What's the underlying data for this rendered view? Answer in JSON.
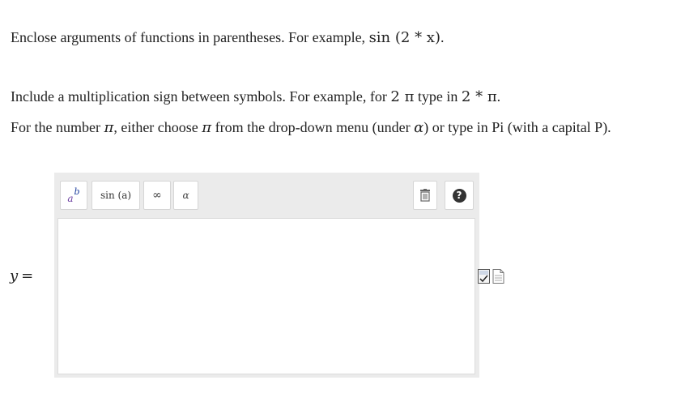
{
  "instructions": {
    "line1_text": "Enclose arguments of functions in parentheses. For example, ",
    "line1_example": "sin (2 * x)",
    "line1_end": ".",
    "line2_text": "Include a multiplication sign between symbols. For example, for ",
    "line2_example_a": "2 π",
    "line2_mid": " type in ",
    "line2_example_b": "2 * π",
    "line2_end": ".",
    "line3_text_a": "For the number ",
    "line3_pi": "π",
    "line3_text_b": ", either choose ",
    "line3_pi2": "π",
    "line3_text_c": " from the drop-down menu (under ",
    "line3_alpha": "α",
    "line3_text_d": ") or type in Pi (with a capital P)."
  },
  "answer": {
    "lhs_var": "y",
    "lhs_eq": "="
  },
  "toolbar": {
    "power_base": "a",
    "power_exp": "b",
    "func_label": "sin (a)",
    "infinity_label": "∞",
    "greek_label": "α"
  },
  "icons": {
    "trash": "trash-icon",
    "help": "help-icon",
    "help_glyph": "?",
    "spellcheck": "equation-preview-icon",
    "doc": "document-icon"
  },
  "colors": {
    "toolbar_bg": "#ebebeb",
    "power_base": "#6b3fa0",
    "power_exp": "#1a3c9c"
  }
}
